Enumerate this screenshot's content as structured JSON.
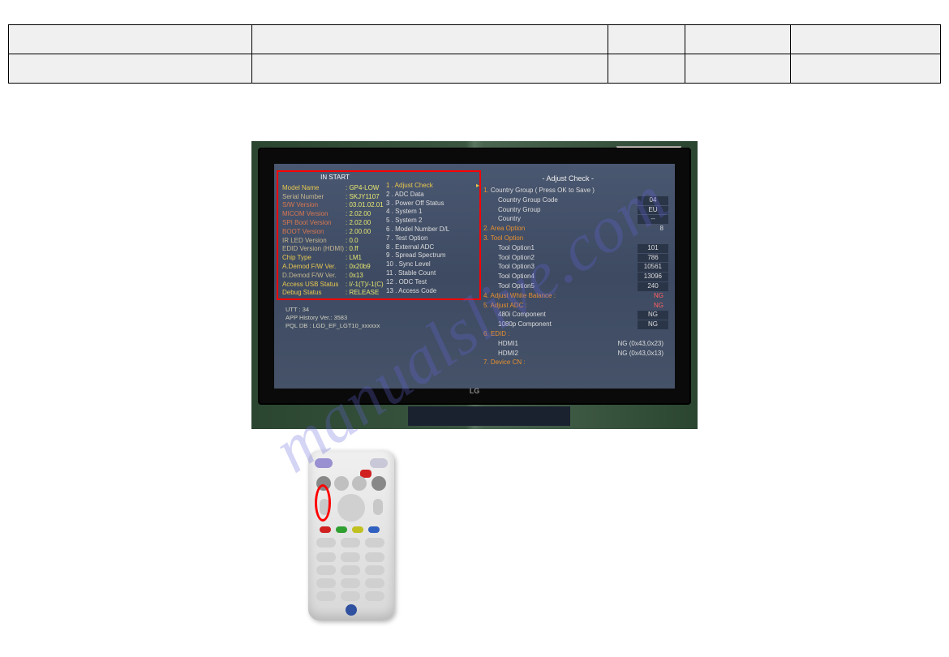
{
  "watermark": "manualslive.com",
  "tv": {
    "instart": "IN START",
    "left": [
      {
        "lbl": "Model Name",
        "cls": "y",
        "val": ": GP4-LOW"
      },
      {
        "lbl": "Serial Number",
        "cls": "",
        "val": ": SKJY1107"
      },
      {
        "lbl": "S/W Version",
        "cls": "r",
        "val": ": 03.01.02.01"
      },
      {
        "lbl": "MICOM Version",
        "cls": "r",
        "val": ": 2.02.00"
      },
      {
        "lbl": "SPI Boot Version",
        "cls": "r",
        "val": ": 2.02.00"
      },
      {
        "lbl": "BOOT Version",
        "cls": "r",
        "val": ": 2.00.00"
      },
      {
        "lbl": "IR LED Version",
        "cls": "",
        "val": ": 0.0"
      },
      {
        "lbl": "EDID Version (HDMI)",
        "cls": "",
        "val": ": 0.ff"
      },
      {
        "lbl": "Chip Type",
        "cls": "y",
        "val": ": LM1"
      },
      {
        "lbl": "A.Demod F/W Ver.",
        "cls": "y",
        "val": ": 0x20b9"
      },
      {
        "lbl": "D.Demod F/W Ver.",
        "cls": "",
        "val": ": 0x13"
      },
      {
        "lbl": "Access USB Status",
        "cls": "y",
        "val": ": I/-1(T)/-1(C)"
      },
      {
        "lbl": "Debug Status",
        "cls": "y",
        "val": ": RELEASE"
      }
    ],
    "mid": [
      {
        "t": "1 . Adjust Check",
        "hl": true
      },
      {
        "t": "2 . ADC Data"
      },
      {
        "t": "3 . Power Off Status"
      },
      {
        "t": "4 . System 1"
      },
      {
        "t": "5 . System 2"
      },
      {
        "t": "6 . Model Number D/L"
      },
      {
        "t": "7 . Test Option"
      },
      {
        "t": "8 . External ADC"
      },
      {
        "t": "9 . Spread Spectrum"
      },
      {
        "t": "10 . Sync Level"
      },
      {
        "t": "11 . Stable Count"
      },
      {
        "t": "12 . ODC Test"
      },
      {
        "t": "13 . Access Code"
      }
    ],
    "right_title": "- Adjust Check -",
    "right": [
      {
        "n": "1.",
        "lbl": "Country Group",
        "sfx": " ( Press OK to Save )",
        "val": ""
      },
      {
        "sub": true,
        "lbl": "Country Group Code",
        "val": "04",
        "box": true
      },
      {
        "sub": true,
        "lbl": "Country Group",
        "val": "EU",
        "box": true
      },
      {
        "sub": true,
        "lbl": "Country",
        "val": "--",
        "box": true
      },
      {
        "n": "2.",
        "lbl": "Area Option",
        "val": "8",
        "or": true
      },
      {
        "n": "3.",
        "lbl": "Tool Option",
        "val": "",
        "or": true
      },
      {
        "sub": true,
        "lbl": "Tool Option1",
        "val": "101",
        "box": true
      },
      {
        "sub": true,
        "lbl": "Tool Option2",
        "val": "786",
        "box": true
      },
      {
        "sub": true,
        "lbl": "Tool Option3",
        "val": "10561",
        "box": true
      },
      {
        "sub": true,
        "lbl": "Tool Option4",
        "val": "13096",
        "box": true
      },
      {
        "sub": true,
        "lbl": "Tool Option5",
        "val": "240",
        "box": true
      },
      {
        "n": "4.",
        "lbl": "Adjust White Balance :",
        "val": "NG",
        "or": true,
        "vr": true
      },
      {
        "n": "5.",
        "lbl": "Adjust ADC :",
        "val": "NG",
        "or": true,
        "vr": true
      },
      {
        "sub": true,
        "lbl": "480i Component",
        "val": "NG",
        "box": true
      },
      {
        "sub": true,
        "lbl": "1080p Component",
        "val": "NG",
        "box": true
      },
      {
        "n": "6.",
        "lbl": "EDID :",
        "val": "",
        "or": true,
        "vr": true
      },
      {
        "sub": true,
        "lbl": "HDMI1",
        "val": "NG (0x43,0x23)"
      },
      {
        "sub": true,
        "lbl": "HDMI2",
        "val": "NG (0x43,0x13)"
      },
      {
        "n": "7.",
        "lbl": "Device CN :",
        "val": "",
        "or": true,
        "vr": true
      }
    ],
    "bottom": [
      "UTT : 34",
      "APP History Ver.: 3583",
      "PQL DB : LGD_EF_LGT10_xxxxxx"
    ],
    "lg": "LG"
  }
}
